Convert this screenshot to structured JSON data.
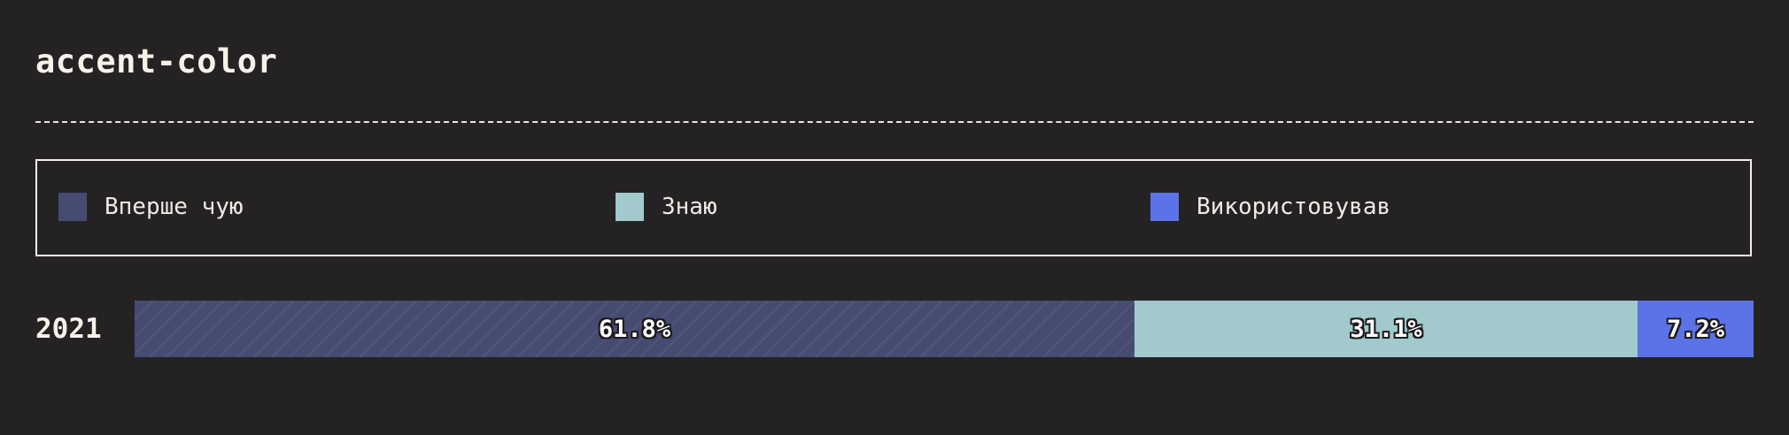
{
  "chart_data": {
    "type": "bar",
    "orientation": "horizontal",
    "stacked": true,
    "title": "accent-color",
    "categories": [
      "2021"
    ],
    "series": [
      {
        "name": "Вперше чую",
        "values": [
          61.8
        ],
        "color": "#464b72",
        "pattern": "hatched"
      },
      {
        "name": "Знаю",
        "values": [
          31.1
        ],
        "color": "#a2cacd"
      },
      {
        "name": "Використовував",
        "values": [
          7.2
        ],
        "color": "#5b73e6"
      }
    ],
    "value_labels": [
      "61.8%",
      "31.1%",
      "7.2%"
    ],
    "unit": "%",
    "legend_position": "top",
    "grid": false
  }
}
